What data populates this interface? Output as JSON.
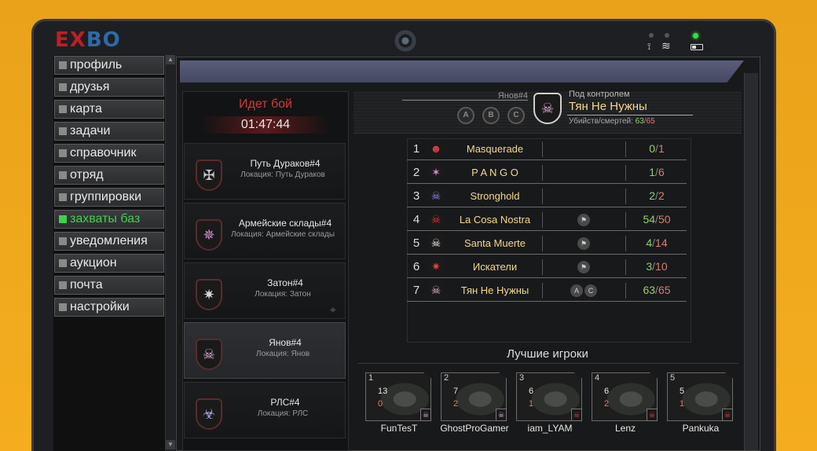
{
  "brand": {
    "logo_part1": "EX",
    "logo_part2": "BO"
  },
  "nav": {
    "items": [
      {
        "label": "профиль",
        "active": false
      },
      {
        "label": "друзья",
        "active": false
      },
      {
        "label": "карта",
        "active": false
      },
      {
        "label": "задачи",
        "active": false
      },
      {
        "label": "справочник",
        "active": false
      },
      {
        "label": "отряд",
        "active": false
      },
      {
        "label": "группировки",
        "active": false
      },
      {
        "label": "захваты баз",
        "active": true
      },
      {
        "label": "уведомления",
        "active": false
      },
      {
        "label": "аукцион",
        "active": false
      },
      {
        "label": "почта",
        "active": false
      },
      {
        "label": "настройки",
        "active": false
      }
    ]
  },
  "battle_status": {
    "title": "Идет бой",
    "timer": "01:47:44"
  },
  "battles": [
    {
      "name": "Путь Дураков#4",
      "location": "Локация: Путь Дураков",
      "emblem_color": "#c8c8c8",
      "selected": false
    },
    {
      "name": "Армейские склады#4",
      "location": "Локация: Армейские склады",
      "emblem_color": "#d98ad0",
      "selected": false
    },
    {
      "name": "Затон#4",
      "location": "Локация: Затон",
      "emblem_color": "#d8d8d8",
      "selected": false
    },
    {
      "name": "Янов#4",
      "location": "Локация: Янов",
      "emblem_color": "#e6b0d8",
      "selected": true
    },
    {
      "name": "РЛС#4",
      "location": "Локация: РЛС",
      "emblem_color": "#a8a8e8",
      "selected": false
    }
  ],
  "detail": {
    "location": "Янов#4",
    "points": [
      "A",
      "B",
      "C"
    ],
    "control_label": "Под контролем",
    "control_clan": "Тян Не Нужны",
    "kd_label": "Убийств/смертей:",
    "kd_kills": "63",
    "kd_deaths": "65"
  },
  "ranking": [
    {
      "rank": "1",
      "clan": "Masquerade",
      "flags": "",
      "kills": "0",
      "deaths": "1",
      "emblem_color": "#d84040"
    },
    {
      "rank": "2",
      "clan": "P A N G O",
      "flags": "",
      "kills": "1",
      "deaths": "6",
      "emblem_color": "#d98ad0"
    },
    {
      "rank": "3",
      "clan": "Stronghold",
      "flags": "",
      "kills": "2",
      "deaths": "2",
      "emblem_color": "#8a8ae8"
    },
    {
      "rank": "4",
      "clan": "La Cosa Nostra",
      "flags": "flag",
      "kills": "54",
      "deaths": "50",
      "emblem_color": "#e03030"
    },
    {
      "rank": "5",
      "clan": "Santa Muerte",
      "flags": "flag",
      "kills": "4",
      "deaths": "14",
      "emblem_color": "#eeeeee"
    },
    {
      "rank": "6",
      "clan": "Искатели",
      "flags": "flag",
      "kills": "3",
      "deaths": "10",
      "emblem_color": "#e04040"
    },
    {
      "rank": "7",
      "clan": "Тян Не Нужны",
      "flags": "A C",
      "kills": "63",
      "deaths": "65",
      "emblem_color": "#e6b0d8"
    }
  ],
  "best_players": {
    "title": "Лучшие игроки",
    "players": [
      {
        "rank": "1",
        "kills": "13",
        "deaths": "0",
        "name": "FunTesT"
      },
      {
        "rank": "2",
        "kills": "7",
        "deaths": "2",
        "name": "GhostProGamer"
      },
      {
        "rank": "3",
        "kills": "6",
        "deaths": "1",
        "name": "iam_LYAM"
      },
      {
        "rank": "4",
        "kills": "6",
        "deaths": "2",
        "name": "Lenz"
      },
      {
        "rank": "5",
        "kills": "5",
        "deaths": "1",
        "name": "Pankuka"
      }
    ]
  }
}
